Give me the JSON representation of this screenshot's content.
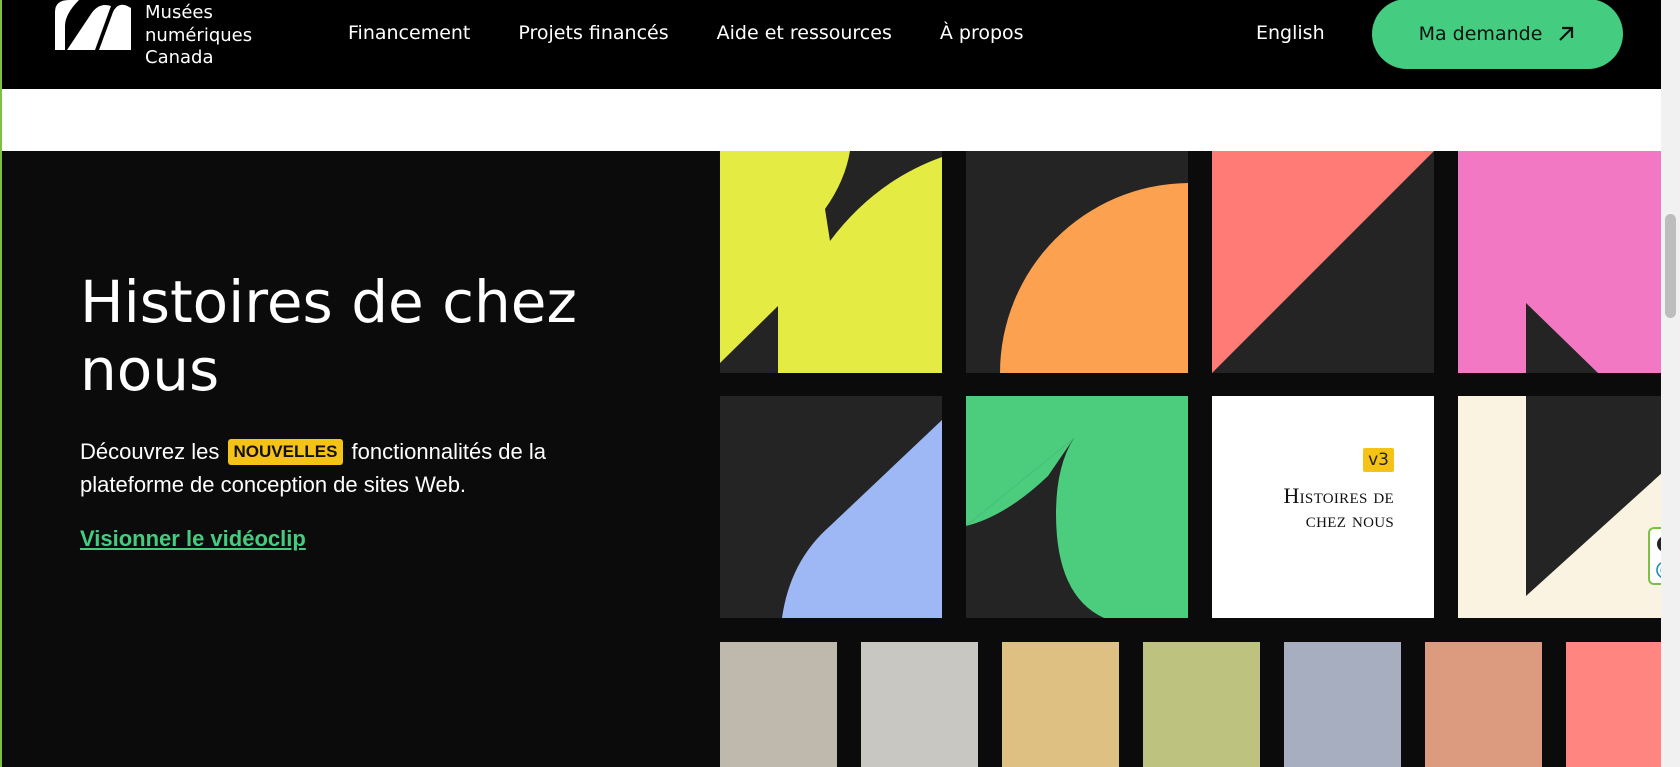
{
  "header": {
    "logo_lines": [
      "Musées",
      "numériques",
      "Canada"
    ],
    "nav": [
      "Financement",
      "Projets financés",
      "Aide et ressources",
      "À propos"
    ],
    "language": "English",
    "cta_label": "Ma demande"
  },
  "hero": {
    "title": "Histoires de chez nous",
    "desc_before": "Découvrez les",
    "badge": "NOUVELLES",
    "desc_after": "fonctionnalités de la plateforme de conception de sites Web.",
    "link": "Visionner le vidéoclip"
  },
  "feature_tile": {
    "version": "v3",
    "line1": "Histoires de",
    "line2": "chez nous"
  },
  "colors": {
    "accent_green": "#44cc80",
    "badge_yellow": "#f5c217",
    "tile_yellow": "#e4ec44",
    "tile_orange": "#fba14f",
    "tile_coral": "#ff7b75",
    "tile_pink": "#f378c4",
    "tile_blue": "#9eb7f5",
    "tile_green": "#4ccc7d",
    "tile_cream": "#faf3e1",
    "swatches": [
      "#bfb8ad",
      "#c8c7c2",
      "#dfc083",
      "#bdc37f",
      "#a6aec0",
      "#dc9b7f",
      "#fe8580"
    ]
  },
  "icons": [
    "logo-mark-icon",
    "arrow-up-right-icon",
    "close-icon",
    "e-icon"
  ]
}
